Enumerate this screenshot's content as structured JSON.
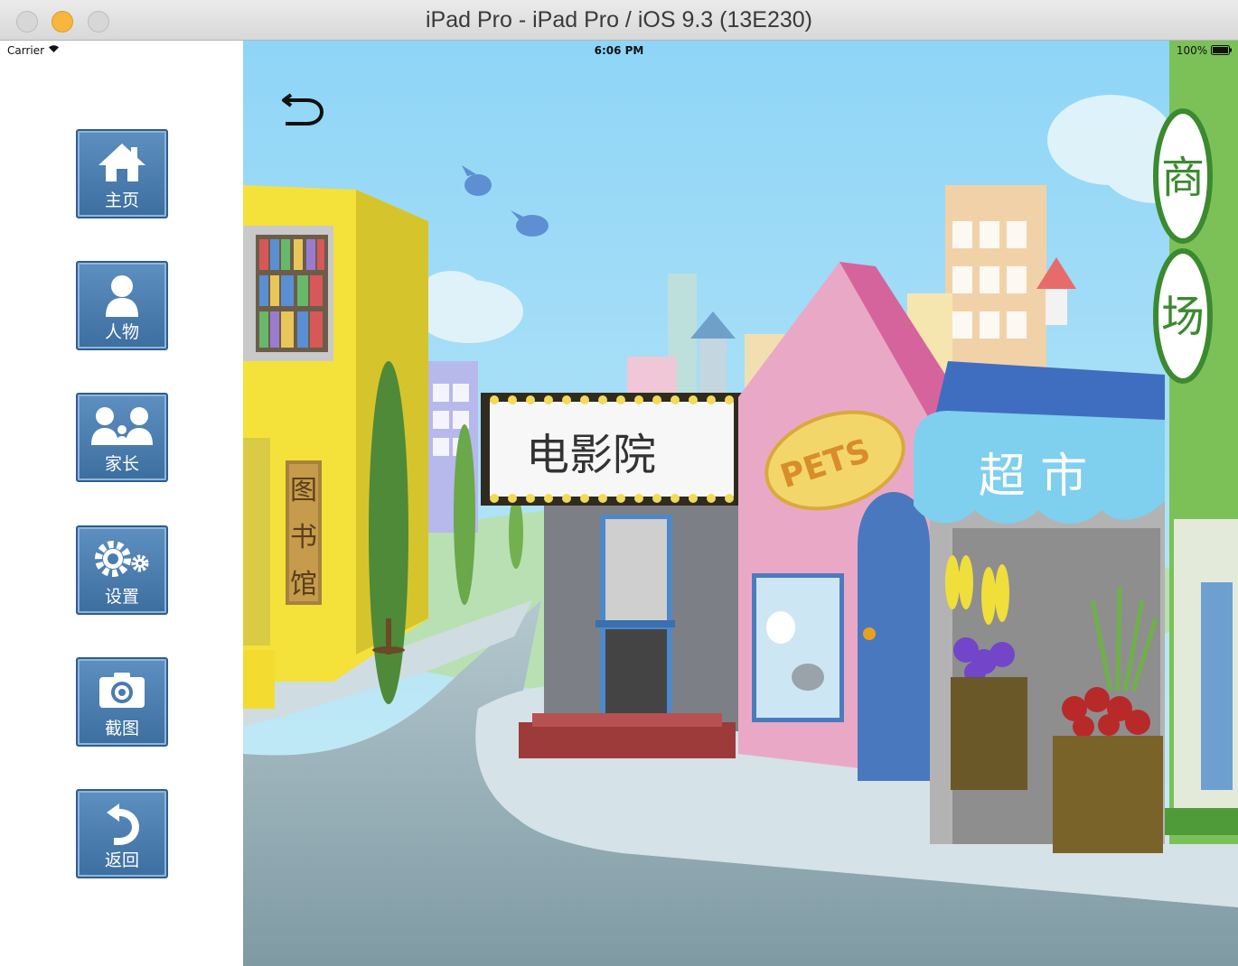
{
  "window": {
    "title": "iPad Pro - iPad Pro / iOS 9.3 (13E230)"
  },
  "status_bar": {
    "carrier": "Carrier",
    "time": "6:06 PM",
    "battery": "100%"
  },
  "sidebar": {
    "items": [
      {
        "label": "主页",
        "icon": "home-icon"
      },
      {
        "label": "人物",
        "icon": "person-icon"
      },
      {
        "label": "家长",
        "icon": "parents-icon"
      },
      {
        "label": "设置",
        "icon": "gear-icon"
      },
      {
        "label": "截图",
        "icon": "camera-icon"
      },
      {
        "label": "返回",
        "icon": "return-icon"
      }
    ]
  },
  "scene": {
    "library_sign": [
      "图",
      "书",
      "馆"
    ],
    "cinema_sign": "电影院",
    "pets_sign": "PETS",
    "supermarket_sign": "超 市",
    "mall_sign": [
      "商",
      "场"
    ]
  },
  "colors": {
    "sky": "#a8dcf5",
    "button_blue": "#4a7cae",
    "library_yellow": "#f4e13a",
    "pet_shop_pink": "#e9a9c6",
    "supermarket_awning": "#7fcfee",
    "mall_green": "#7cc158"
  }
}
